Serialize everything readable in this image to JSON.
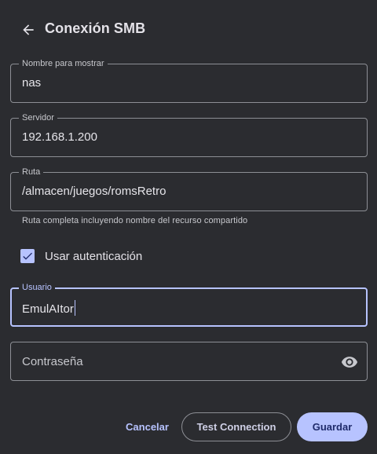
{
  "header": {
    "back_icon": "arrow-left-icon",
    "title": "Conexión SMB"
  },
  "fields": {
    "display_name": {
      "label": "Nombre para mostrar",
      "value": "nas"
    },
    "server": {
      "label": "Servidor",
      "value": "192.168.1.200"
    },
    "path": {
      "label": "Ruta",
      "value": "/almacen/juegos/romsRetro",
      "helper": "Ruta completa incluyendo nombre del recurso compartido"
    },
    "username": {
      "label": "Usuario",
      "value": "EmulAItor",
      "focused": true
    },
    "password": {
      "placeholder": "Contraseña",
      "toggle_icon": "eye-icon"
    }
  },
  "auth": {
    "label": "Usar autenticación",
    "checked": true
  },
  "actions": {
    "cancel": "Cancelar",
    "test": "Test Connection",
    "save": "Guardar"
  },
  "colors": {
    "background": "#2b2c30",
    "accent": "#b7c3ff",
    "outline": "#8d8f95",
    "text": "#e4e2e8",
    "on_accent": "#1f2b6b"
  }
}
